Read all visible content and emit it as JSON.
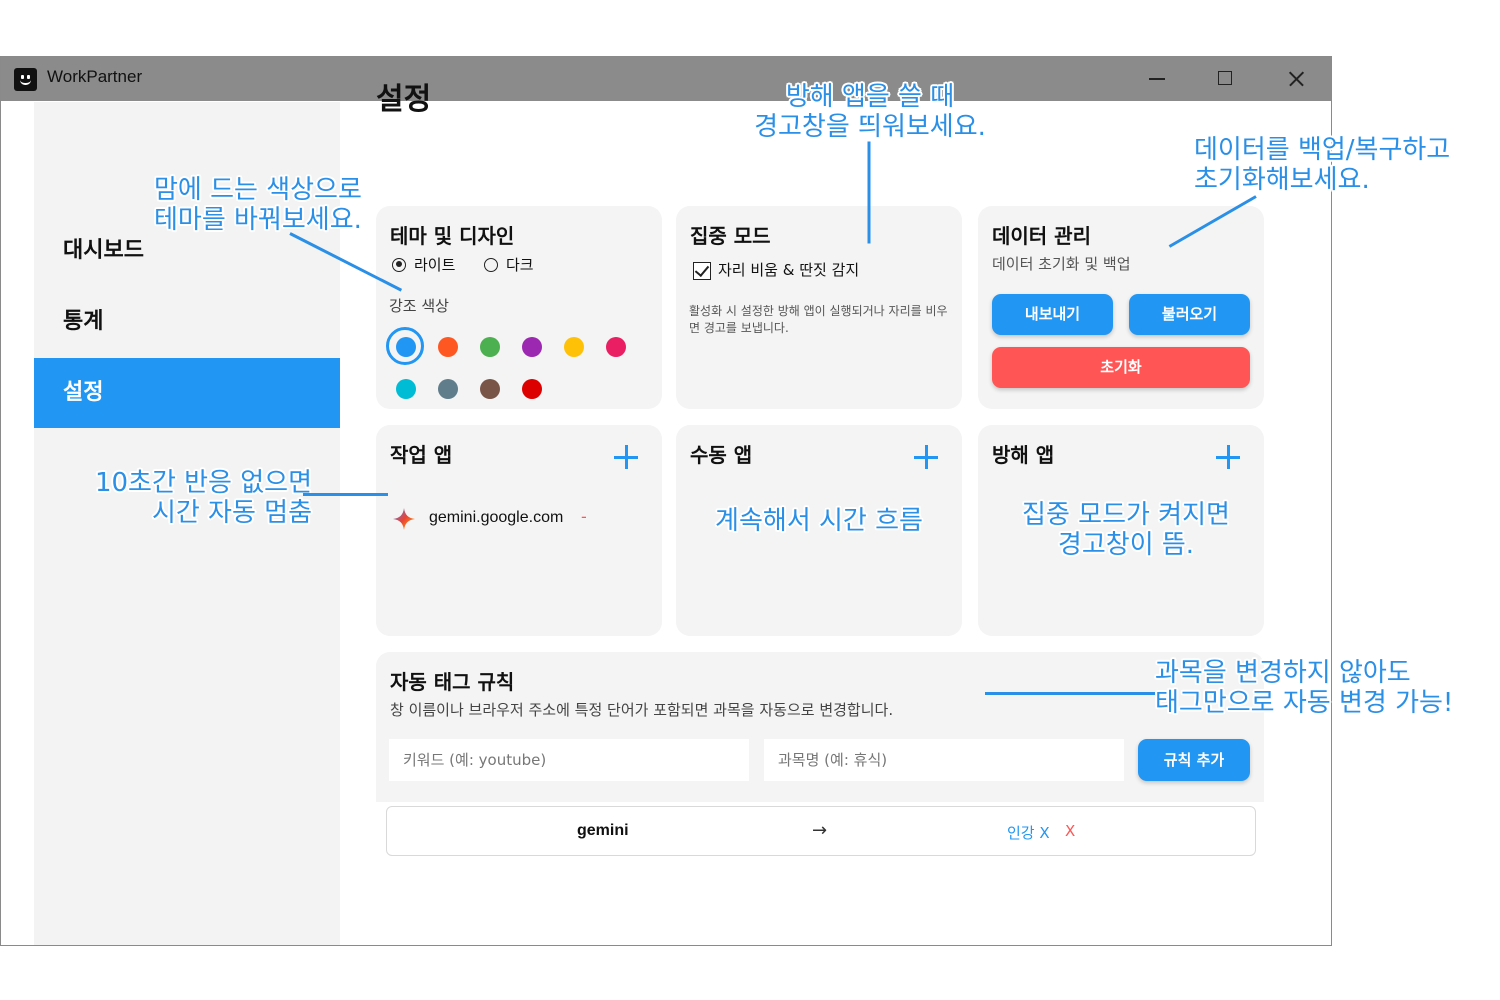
{
  "window": {
    "title": "WorkPartner",
    "controls": {
      "minimize": "minimize",
      "maximize": "maximize",
      "close": "close"
    }
  },
  "sidebar": {
    "items": [
      {
        "label": "대시보드",
        "active": false
      },
      {
        "label": "통계",
        "active": false
      },
      {
        "label": "설정",
        "active": true
      }
    ]
  },
  "page": {
    "title": "설정"
  },
  "theme_card": {
    "title": "테마 및 디자인",
    "options": [
      {
        "label": "라이트",
        "selected": true
      },
      {
        "label": "다크",
        "selected": false
      }
    ],
    "accent_label": "강조 색상",
    "colors": [
      "#2196f3",
      "#ff5722",
      "#4caf50",
      "#9c27b0",
      "#ffc107",
      "#e91e63",
      "#00bcd4",
      "#607d8b",
      "#795548",
      "#dd0000"
    ],
    "selected_color": "#2196f3"
  },
  "focus_card": {
    "title": "집중 모드",
    "checkbox_label": "자리 비움 & 딴짓 감지",
    "checked": true,
    "description": "활성화 시 설정한 방해 앱이 실행되거나 자리를 비우면 경고를 보냅니다."
  },
  "data_card": {
    "title": "데이터 관리",
    "subtitle": "데이터 초기화 및 백업",
    "export_label": "내보내기",
    "import_label": "불러오기",
    "reset_label": "초기화"
  },
  "work_apps": {
    "title": "작업 앱",
    "items": [
      {
        "name": "gemini.google.com",
        "remove": "-"
      }
    ]
  },
  "manual_apps": {
    "title": "수동 앱"
  },
  "block_apps": {
    "title": "방해 앱"
  },
  "tag_rules": {
    "title": "자동 태그 규칙",
    "description": "창 이름이나 브라우저 주소에 특정 단어가 포함되면 과목을 자동으로 변경합니다.",
    "keyword_placeholder": "키워드 (예: youtube)",
    "subject_placeholder": "과목명 (예: 휴식)",
    "add_label": "규칙 추가",
    "rules": [
      {
        "keyword": "gemini",
        "arrow": "→",
        "subject": "인강 X",
        "delete": "X"
      }
    ]
  },
  "annotations": {
    "focus_line1": "방해 앱을 쓸 때",
    "focus_line2": "경고창을 띄워보세요.",
    "data_line1": "데이터를 백업/복구하고",
    "data_line2": "초기화해보세요.",
    "theme_line1": "맘에 드는 색상으로",
    "theme_line2": "테마를 바꿔보세요.",
    "idle_line1": "10초간 반응 없으면",
    "idle_line2": "시간 자동 멈춤",
    "manual_note": "계속해서 시간 흐름",
    "block_line1": "집중 모드가 켜지면",
    "block_line2": "경고창이 뜸.",
    "tag_line1": "과목을 변경하지 않아도",
    "tag_line2": "태그만으로 자동 변경 가능!"
  },
  "colors": {
    "accent": "#2196f3",
    "danger": "#ff5555",
    "annotation": "#2a8fe6",
    "titlebar": "#8b8b8b"
  }
}
